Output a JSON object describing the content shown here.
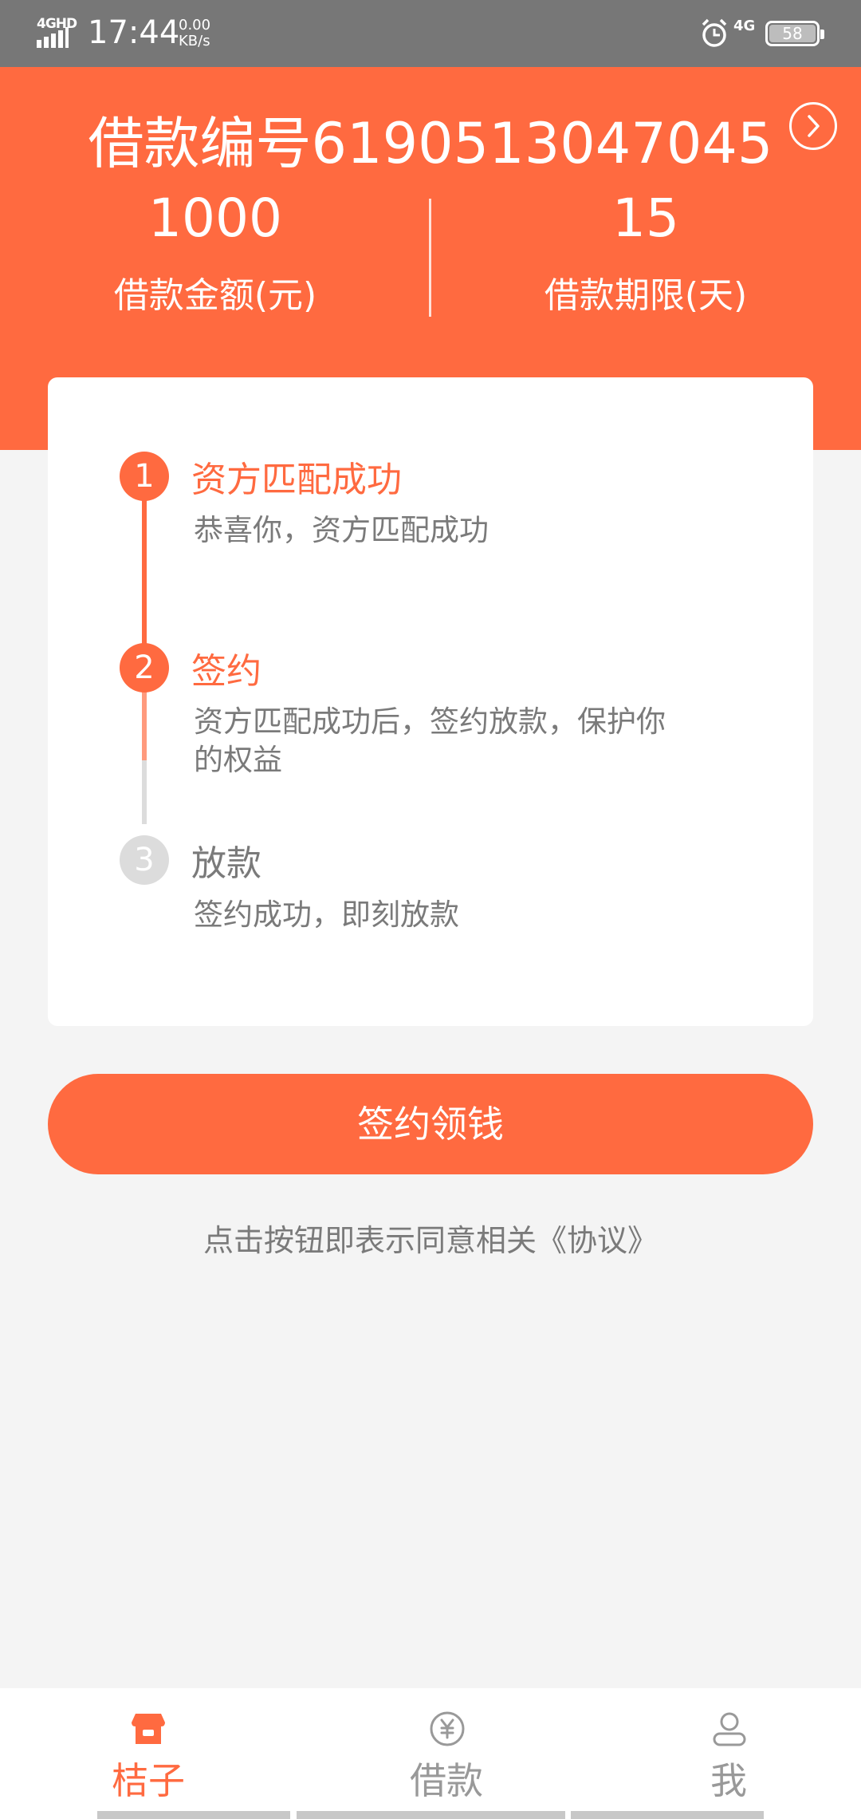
{
  "status_bar": {
    "network": "4GHD",
    "time": "17:44",
    "speed_value": "0.00",
    "speed_unit": "KB/s",
    "signal_label": "4G",
    "battery": "58"
  },
  "header": {
    "loan_number": "借款编号6190513047045",
    "amount_value": "1000",
    "amount_label": "借款金额(元)",
    "term_value": "15",
    "term_label": "借款期限(天)"
  },
  "steps": [
    {
      "number": "1",
      "title": "资方匹配成功",
      "desc": "恭喜你，资方匹配成功",
      "state": "done"
    },
    {
      "number": "2",
      "title": "签约",
      "desc_line1": "资方匹配成功后，签约放款，保护你",
      "desc_line2": "的权益",
      "state": "current"
    },
    {
      "number": "3",
      "title": "放款",
      "desc": "签约成功，即刻放款",
      "state": "pending"
    }
  ],
  "action": {
    "button_label": "签约领钱",
    "agreement_text": "点击按钮即表示同意相关《协议》"
  },
  "bottom_nav": [
    {
      "label": "桔子",
      "icon": "store-icon",
      "active": true
    },
    {
      "label": "借款",
      "icon": "yuan-icon",
      "active": false
    },
    {
      "label": "我",
      "icon": "person-icon",
      "active": false
    }
  ],
  "colors": {
    "accent": "#ff6a40",
    "inactive": "#999999",
    "pending": "#dcdcdc"
  }
}
